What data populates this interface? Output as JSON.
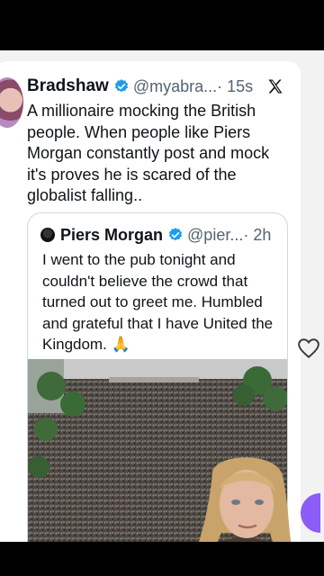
{
  "tweet": {
    "author_name": "Bradshaw",
    "handle": "@myabra...",
    "time": "· 15s",
    "text": "A millionaire mocking the British people. When people like Piers Morgan constantly post and mock it's proves he is scared of the globalist falling..",
    "platform_icon": "x-logo-icon"
  },
  "quote": {
    "author_name": "Piers Morgan",
    "handle": "@pier...",
    "time": "· 2h",
    "text": "I went to the pub tonight and couldn't believe the crowd that turned out to greet me. Humbled and grateful that I have United the Kingdom. 🙏"
  },
  "colors": {
    "verified": "#1d9bf0",
    "text": "#0f1419",
    "muted": "#536471",
    "border": "#cfd9de",
    "accent_purple": "#8b5cf6"
  },
  "icons": [
    "verified-badge-icon",
    "x-logo-icon",
    "heart-icon"
  ]
}
